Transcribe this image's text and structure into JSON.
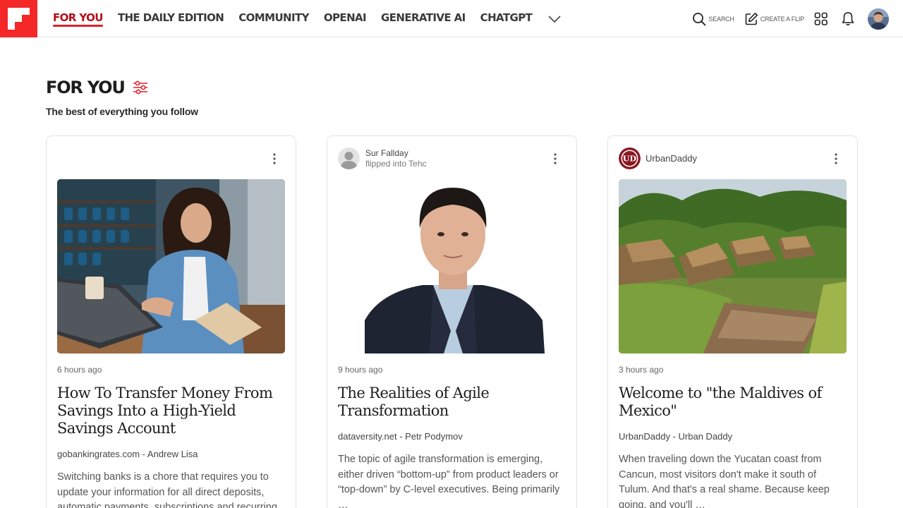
{
  "colors": {
    "brand": "#f52828",
    "accent": "#e0222c"
  },
  "nav": {
    "items": [
      {
        "label": "FOR YOU",
        "active": true
      },
      {
        "label": "THE DAILY EDITION",
        "active": false
      },
      {
        "label": "COMMUNITY",
        "active": false
      },
      {
        "label": "OPENAI",
        "active": false
      },
      {
        "label": "GENERATIVE AI",
        "active": false
      },
      {
        "label": "CHATGPT",
        "active": false
      }
    ],
    "more_icon": "chevron-down-icon"
  },
  "tools": {
    "search_label": "SEARCH",
    "create_label": "CREATE A FLIP"
  },
  "page": {
    "title": "FOR YOU",
    "subtitle": "The best of everything you follow"
  },
  "cards": [
    {
      "time": "6 hours ago",
      "title": "How To Transfer Money From Savings Into a High-Yield Savings Account",
      "source": "gobankingrates.com - Andrew Lisa",
      "excerpt": "Switching banks is a chore that requires you to update your information for all direct deposits, automatic payments, subscriptions and recurring"
    },
    {
      "flipper": "Sur Fallday",
      "flipped_into": "flipped into Tehc",
      "time": "9 hours ago",
      "title": "The Realities of Agile Transformation",
      "source": "dataversity.net - Petr Podymov",
      "excerpt": "The topic of agile transformation is emerging, either driven “bottom-up” from product leaders or “top-down” by C-level executives. Being primarily …"
    },
    {
      "publisher": "UrbanDaddy",
      "time": "3 hours ago",
      "title": "Welcome to \"the Maldives of Mexico\"",
      "source": "UrbanDaddy - Urban Daddy",
      "excerpt": "When traveling down the Yucatan coast from Cancun, most visitors don't make it south of Tulum. And that's a real shame. Because keep going, and you'll …"
    }
  ]
}
